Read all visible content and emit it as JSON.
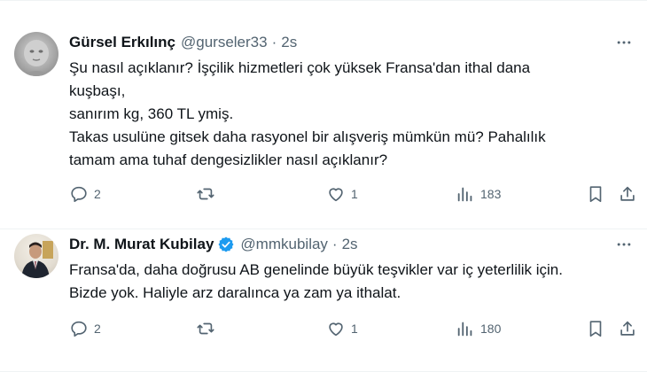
{
  "tweets": [
    {
      "display_name": "Gürsel Erkılınç",
      "handle": "@gurseler33",
      "separator": "·",
      "time": "2s",
      "verified": false,
      "lines": [
        "Şu nasıl açıklanır? İşçilik hizmetleri çok yüksek Fransa'dan ithal dana",
        "kuşbaşı,",
        "sanırım kg, 360 TL ymiş.",
        "Takas usulüne gitsek daha rasyonel bir alışveriş mümkün mü? Pahalılık",
        "tamam ama tuhaf dengesizlikler nasıl açıklanır?"
      ],
      "replies": "2",
      "retweets": "",
      "likes": "1",
      "views": "183"
    },
    {
      "display_name": "Dr. M. Murat Kubilay",
      "handle": "@mmkubilay",
      "separator": "·",
      "time": "2s",
      "verified": true,
      "lines": [
        "Fransa'da, daha doğrusu AB genelinde büyük teşvikler var iç yeterlilik için.",
        "Bizde yok. Haliyle arz daralınca ya zam ya ithalat."
      ],
      "replies": "2",
      "retweets": "",
      "likes": "1",
      "views": "180"
    }
  ],
  "icons": {
    "reply": "reply-icon",
    "retweet": "retweet-icon",
    "like": "heart-icon",
    "views": "views-icon",
    "bookmark": "bookmark-icon",
    "share": "share-icon",
    "more": "more-icon",
    "verified": "verified-badge-icon"
  },
  "colors": {
    "text": "#0f1419",
    "secondary": "#536471",
    "verified": "#1d9bf0",
    "divider": "#eff3f4"
  }
}
